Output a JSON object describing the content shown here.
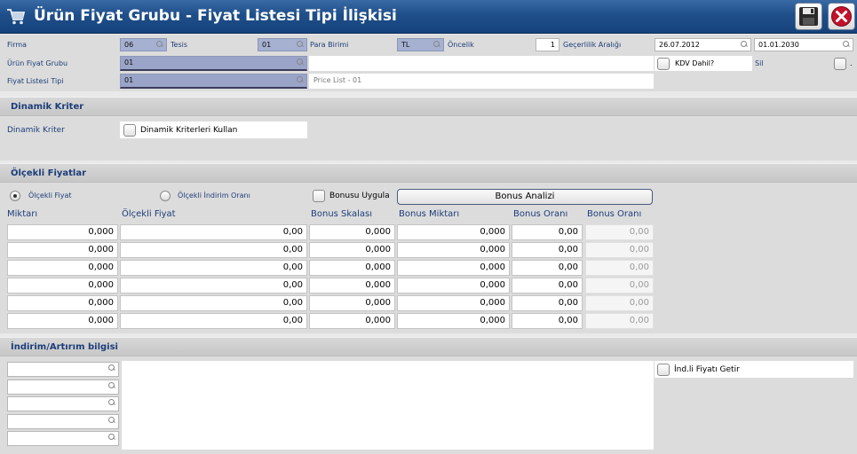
{
  "window": {
    "title": "Ürün Fiyat Grubu - Fiyat Listesi Tipi İlişkisi",
    "icon": "shopping-cart-icon",
    "save_icon": "floppy-disk-icon",
    "close_icon": "close-icon"
  },
  "header": {
    "firma_label": "Firma",
    "firma_value": "06",
    "tesis_label": "Tesis",
    "tesis_value": "01",
    "para_birimi_label": "Para Birimi",
    "para_birimi_value": "TL",
    "oncelik_label": "Öncelik",
    "oncelik_value": "1",
    "gecerlilik_label": "Geçerlilik Aralığı",
    "date_start": "26.07.2012",
    "date_end": "01.01.2030",
    "urun_fiyat_grubu_label": "Ürün Fiyat Grubu",
    "urun_fiyat_grubu_value": "01",
    "kdv_dahil_label": "KDV Dahil?",
    "sil_label": "Sil",
    "sil_extra": ".",
    "fiyat_listesi_tipi_label": "Fiyat Listesi Tipi",
    "fiyat_listesi_tipi_value": "01",
    "fiyat_listesi_desc": "Price List - 01"
  },
  "dinamik": {
    "section_title": "Dinamik Kriter",
    "label": "Dinamik Kriter",
    "checkbox_label": "Dinamik Kriterleri Kullan"
  },
  "olcekli": {
    "section_title": "Ölçekli Fiyatlar",
    "radio_olcekli_fiyat": "Ölçekli Fiyat",
    "radio_indirim_orani": "Ölçekli İndirim Oranı",
    "bonus_uygula": "Bonusu Uygula",
    "bonus_analizi": "Bonus Analizi",
    "columns": [
      "Miktarı",
      "Ölçekli Fiyat",
      "Bonus Skalası",
      "Bonus Miktarı",
      "Bonus Oranı",
      "Bonus Oranı"
    ],
    "rows": [
      [
        "0,000",
        "0,00",
        "0,000",
        "0,000",
        "0,00",
        "0,00"
      ],
      [
        "0,000",
        "0,00",
        "0,000",
        "0,000",
        "0,00",
        "0,00"
      ],
      [
        "0,000",
        "0,00",
        "0,000",
        "0,000",
        "0,00",
        "0,00"
      ],
      [
        "0,000",
        "0,00",
        "0,000",
        "0,000",
        "0,00",
        "0,00"
      ],
      [
        "0,000",
        "0,00",
        "0,000",
        "0,000",
        "0,00",
        "0,00"
      ],
      [
        "0,000",
        "0,00",
        "0,000",
        "0,000",
        "0,00",
        "0,00"
      ]
    ]
  },
  "indirim": {
    "section_title": "İndirim/Artırım bilgisi",
    "checkbox_label": "İnd.li Fiyatı Getir"
  },
  "colors": {
    "title_bar": "#1f4f8a",
    "label_text": "#1c3d79",
    "selected_field": "#a6b1d1"
  }
}
